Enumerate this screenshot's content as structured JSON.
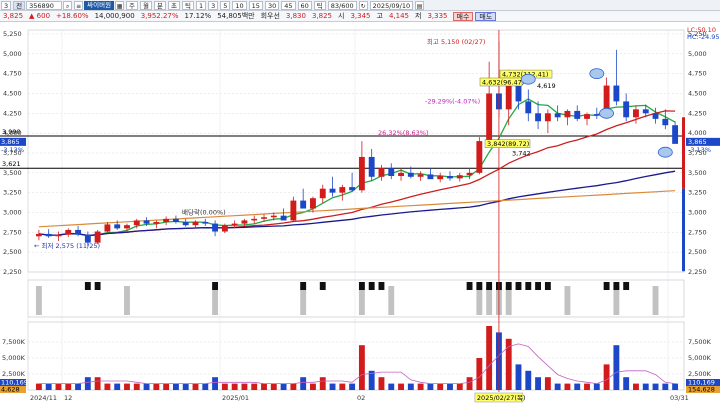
{
  "toolbar": {
    "market": "3",
    "market_label": "전",
    "code": "356890",
    "name": "싸이버원",
    "period_buttons": [
      "주",
      "월",
      "분",
      "초",
      "틱"
    ],
    "interval_buttons": [
      "1",
      "3",
      "5",
      "10",
      "15",
      "30",
      "45",
      "60",
      "틱"
    ],
    "count": "83/600",
    "date": "2025/09/10"
  },
  "quote": {
    "price": "3,825",
    "change": "▲ 600",
    "change_pct": "+18.60%",
    "volume": "14,000,900",
    "amount_ratio": "3,952.27%",
    "turnover": "17.12%",
    "value": "54,805백만",
    "group": "회우선",
    "ask": "3,830",
    "bid": "3,825",
    "open_label": "시",
    "open": "3,345",
    "high_label": "고",
    "high": "4,145",
    "low_label": "저",
    "low": "3,335",
    "buy_label": "매수",
    "sell_label": "매도"
  },
  "price_axis": {
    "ticks": [
      "5,250",
      "5,000",
      "4,750",
      "4,500",
      "4,250",
      "4,000",
      "3,750",
      "3,500",
      "3,250",
      "3,000",
      "2,750",
      "2,500",
      "2,250"
    ]
  },
  "volume_axis": {
    "ticks": [
      "7,500K",
      "5,000K",
      "2,500K"
    ]
  },
  "x_axis": {
    "labels": [
      "2024/11",
      "12",
      "2025/01",
      "02",
      "03/31"
    ]
  },
  "right_badges": {
    "lc": "LC:50.10",
    "hc": "HC:-24.95",
    "current": "3,865",
    "current_pct": "-3.13%",
    "vol_current": "110,169",
    "vol_ma": "154,628"
  },
  "left_badges": {
    "current": "3,865",
    "current_pct": "-3.13%",
    "vol_current": "110,169",
    "vol_ma": "4,628"
  },
  "annotations": {
    "high_label": "최고 5,150 (02/27)",
    "low_label": "← 최저 2,575 (11/25)",
    "level_3990": "3,990",
    "level_3621": "3,621",
    "pct_up": "26.32%(8.63%)",
    "pct_down": "-29.29%(-4.07%)",
    "dividend": "배당락(0.00%)",
    "box1": "4,732(112.41)",
    "box1_low": "4,619",
    "box2": "4,632(96.47)",
    "box3": "3,842(89.72)",
    "box3_low": "3,742",
    "date_marker": "2025/02/27(목)"
  },
  "colors": {
    "up": "#d21b1b",
    "down": "#1b47c8",
    "ma5": "#22aa44",
    "ma20": "#cc2020",
    "ma60": "#1a1a90",
    "ma120": "#d98a3a",
    "grid": "#d8dbe2",
    "marker": "#ffff66"
  },
  "chart_data": {
    "type": "candlestick",
    "ylim": [
      2250,
      5300
    ],
    "candles": [
      [
        2700,
        2780,
        2650,
        2730
      ],
      [
        2730,
        2790,
        2680,
        2700
      ],
      [
        2700,
        2760,
        2640,
        2720
      ],
      [
        2720,
        2800,
        2690,
        2780
      ],
      [
        2780,
        2830,
        2700,
        2720
      ],
      [
        2720,
        2760,
        2575,
        2620
      ],
      [
        2620,
        2780,
        2600,
        2760
      ],
      [
        2760,
        2880,
        2730,
        2850
      ],
      [
        2850,
        2900,
        2780,
        2800
      ],
      [
        2800,
        2860,
        2760,
        2840
      ],
      [
        2840,
        2920,
        2800,
        2900
      ],
      [
        2900,
        2940,
        2830,
        2860
      ],
      [
        2860,
        2900,
        2800,
        2880
      ],
      [
        2880,
        2950,
        2840,
        2920
      ],
      [
        2920,
        2960,
        2860,
        2880
      ],
      [
        2880,
        2920,
        2820,
        2840
      ],
      [
        2840,
        2900,
        2800,
        2880
      ],
      [
        2880,
        2920,
        2830,
        2860
      ],
      [
        2860,
        2900,
        2700,
        2760
      ],
      [
        2760,
        2860,
        2740,
        2840
      ],
      [
        2840,
        2900,
        2800,
        2860
      ],
      [
        2860,
        2920,
        2820,
        2900
      ],
      [
        2900,
        2960,
        2860,
        2920
      ],
      [
        2920,
        2980,
        2880,
        2940
      ],
      [
        2940,
        3000,
        2900,
        2960
      ],
      [
        2960,
        3050,
        2930,
        2900
      ],
      [
        2900,
        3200,
        2890,
        3150
      ],
      [
        3150,
        3300,
        3100,
        3050
      ],
      [
        3050,
        3200,
        3000,
        3180
      ],
      [
        3180,
        3350,
        3120,
        3300
      ],
      [
        3300,
        3450,
        3200,
        3250
      ],
      [
        3250,
        3350,
        3150,
        3320
      ],
      [
        3320,
        3500,
        3260,
        3280
      ],
      [
        3280,
        3900,
        3250,
        3700
      ],
      [
        3700,
        3800,
        3400,
        3450
      ],
      [
        3450,
        3600,
        3400,
        3560
      ],
      [
        3560,
        3620,
        3420,
        3460
      ],
      [
        3460,
        3560,
        3400,
        3500
      ],
      [
        3500,
        3580,
        3430,
        3450
      ],
      [
        3450,
        3520,
        3400,
        3480
      ],
      [
        3480,
        3560,
        3430,
        3420
      ],
      [
        3420,
        3500,
        3380,
        3460
      ],
      [
        3460,
        3520,
        3400,
        3430
      ],
      [
        3430,
        3500,
        3390,
        3470
      ],
      [
        3470,
        3560,
        3420,
        3500
      ],
      [
        3500,
        3950,
        3480,
        3900
      ],
      [
        3900,
        4900,
        3850,
        4500
      ],
      [
        4500,
        5150,
        4200,
        4300
      ],
      [
        4300,
        4800,
        4100,
        4700
      ],
      [
        4700,
        4750,
        4300,
        4400
      ],
      [
        4400,
        4550,
        4150,
        4250
      ],
      [
        4250,
        4400,
        4050,
        4150
      ],
      [
        4150,
        4300,
        4000,
        4250
      ],
      [
        4250,
        4350,
        4150,
        4200
      ],
      [
        4200,
        4300,
        4100,
        4280
      ],
      [
        4280,
        4350,
        4150,
        4180
      ],
      [
        4180,
        4260,
        4100,
        4240
      ],
      [
        4240,
        4320,
        4180,
        4220
      ],
      [
        4220,
        4700,
        4200,
        4600
      ],
      [
        4600,
        5050,
        4350,
        4400
      ],
      [
        4400,
        4500,
        4150,
        4200
      ],
      [
        4200,
        4350,
        4120,
        4300
      ],
      [
        4300,
        4360,
        4200,
        4250
      ],
      [
        4250,
        4320,
        4120,
        4180
      ],
      [
        4180,
        4300,
        4050,
        4100
      ],
      [
        4100,
        4150,
        3900,
        3865
      ]
    ],
    "volume": [
      1,
      1,
      1,
      1,
      1,
      2,
      2,
      1,
      1,
      1,
      1,
      1,
      1,
      1,
      1,
      1,
      1,
      1,
      2,
      1,
      1,
      1,
      1,
      1,
      1,
      1,
      1,
      2,
      1,
      2,
      1,
      1,
      1,
      7,
      3,
      2,
      1,
      1,
      1,
      1,
      1,
      1,
      1,
      1,
      2,
      5,
      10,
      9,
      8,
      4,
      3,
      2,
      2,
      1,
      1,
      1,
      1,
      1,
      4,
      7,
      2,
      1,
      1,
      1,
      1,
      1
    ]
  }
}
